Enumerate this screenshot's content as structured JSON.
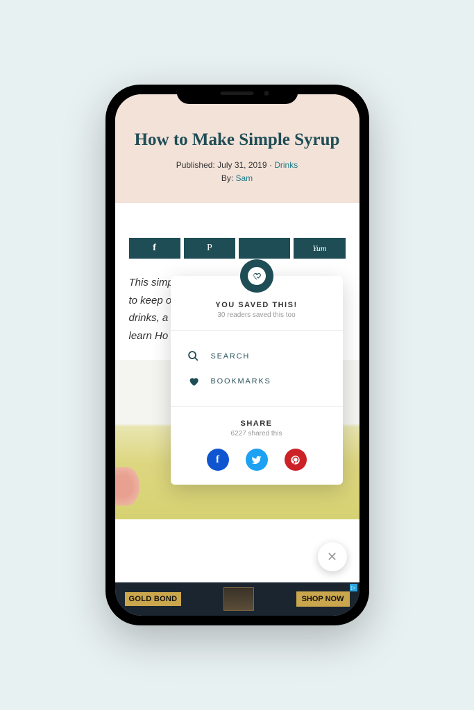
{
  "header": {
    "title": "How to Make Simple Syrup",
    "published_label": "Published:",
    "published_date": "July 31, 2019",
    "category": "Drinks",
    "by_label": "By:",
    "author": "Sam"
  },
  "share_buttons": {
    "facebook": "f",
    "pinterest": "P",
    "grow": "",
    "yummly": "Yum"
  },
  "article": {
    "excerpt_line1": "This simpl",
    "excerpt_line2": "to keep o",
    "excerpt_line3": "drinks, a",
    "excerpt_line4": "learn Ho"
  },
  "popover": {
    "saved_title": "YOU SAVED THIS!",
    "saved_sub": "30 readers saved this too",
    "menu": {
      "search": "SEARCH",
      "bookmarks": "BOOKMARKS"
    },
    "share": {
      "title": "SHARE",
      "sub": "6227 shared this"
    }
  },
  "ad": {
    "brand": "GOLD BOND",
    "cta": "SHOP NOW"
  }
}
